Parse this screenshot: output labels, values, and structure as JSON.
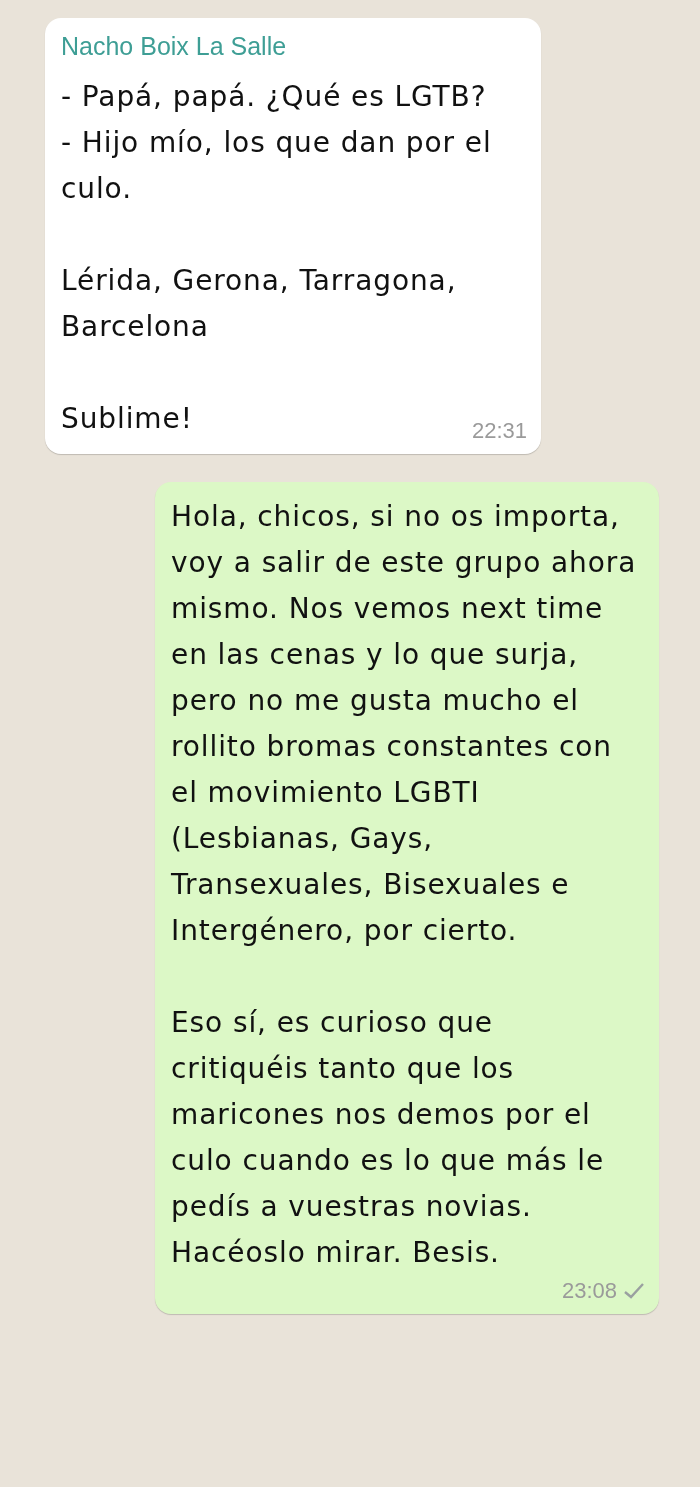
{
  "messages": [
    {
      "kind": "incoming",
      "sender": "Nacho Boix La Salle",
      "paragraphs": [
        "- Papá, papá. ¿Qué es LGTB?\n- Hijo mío, los que dan por el culo.",
        "Lérida, Gerona, Tarragona, Barcelona",
        "Sublime!"
      ],
      "time": "22:31"
    },
    {
      "kind": "outgoing",
      "paragraphs": [
        "Hola, chicos, si no os importa, voy a salir de este grupo ahora mismo. Nos vemos next time en las cenas y lo que surja, pero no me gusta mucho el rollito bromas constantes con el movimiento LGBTI (Lesbianas, Gays, Transexuales, Bisexuales e Intergénero, por cierto.",
        "Eso sí, es curioso que critiquéis tanto que los maricones nos demos por el culo cuando es lo que más le pedís a vuestras novias. Hacéoslo mirar. Besis."
      ],
      "time": "23:08",
      "sent": true
    }
  ]
}
